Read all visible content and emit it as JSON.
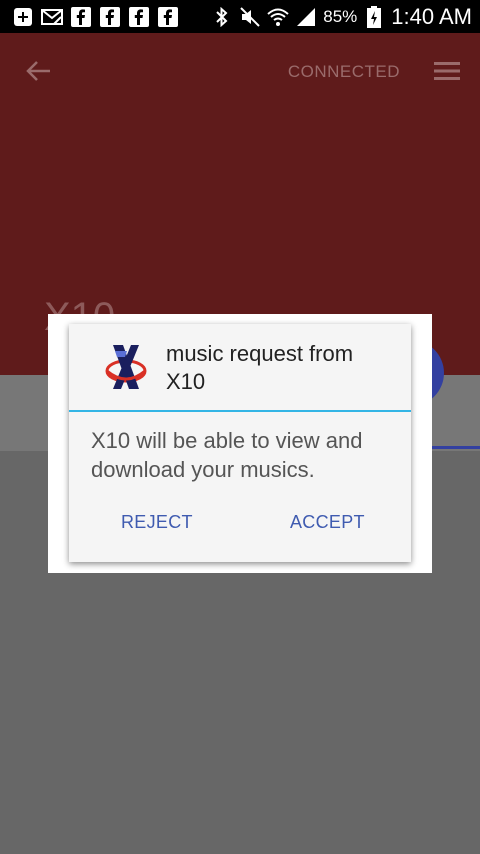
{
  "statusbar": {
    "battery_percent": "85%",
    "time": "1:40 AM",
    "icons": [
      "add-icon",
      "mail-muted-icon",
      "facebook-icon",
      "facebook-icon",
      "facebook-icon",
      "facebook-icon",
      "bluetooth-icon",
      "mute-icon",
      "wifi-icon",
      "signal-icon",
      "battery-charging-icon"
    ]
  },
  "appbar": {
    "status": "CONNECTED",
    "device_title": "X10"
  },
  "dialog": {
    "title": "music request from X10",
    "message": "X10 will be able to view and download your musics.",
    "reject_label": "REJECT",
    "accept_label": "ACCEPT"
  },
  "colors": {
    "appbar": "#5f1b1b",
    "overlay": "#676767",
    "divider": "#33b5e5",
    "button_text": "#3f5bb0",
    "accent": "#3340a0"
  }
}
